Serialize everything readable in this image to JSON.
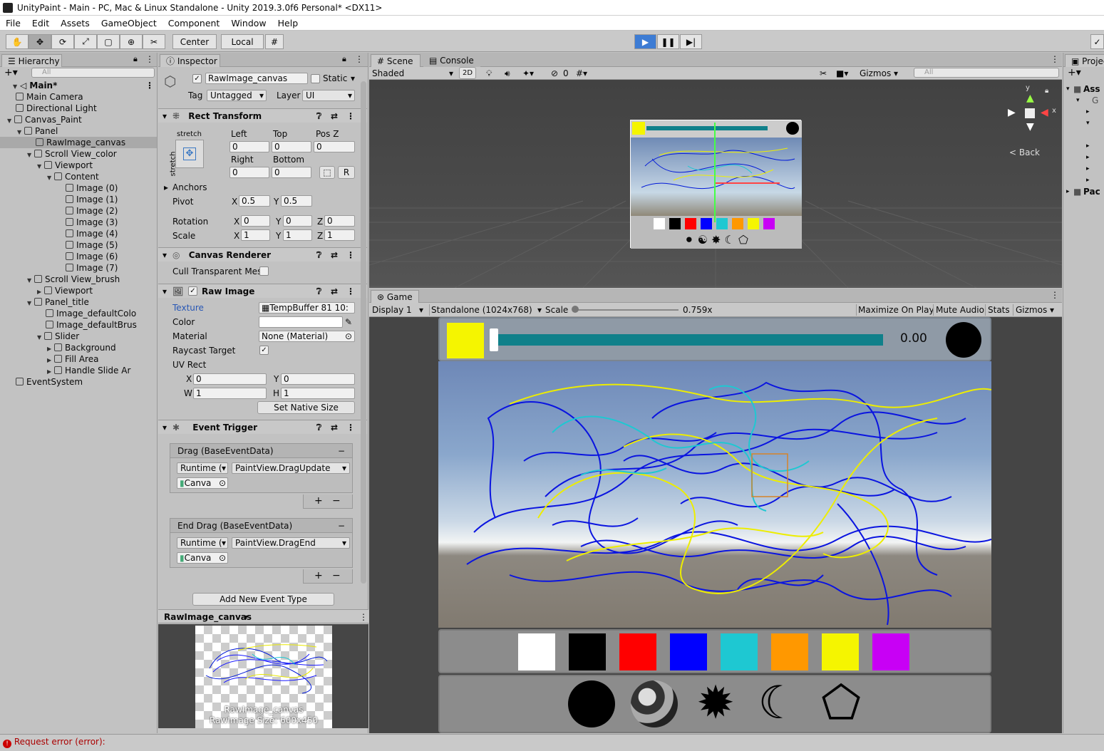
{
  "window_title": "UnityPaint - Main - PC, Mac & Linux Standalone - Unity 2019.3.0f6 Personal* <DX11>",
  "menu": [
    "File",
    "Edit",
    "Assets",
    "GameObject",
    "Component",
    "Window",
    "Help"
  ],
  "toolbar": {
    "center": "Center",
    "local": "Local"
  },
  "hierarchy": {
    "tab": "Hierarchy",
    "search": "All",
    "items": [
      {
        "label": "Main*",
        "depth": 0,
        "scene": true
      },
      {
        "label": "Main Camera",
        "depth": 1
      },
      {
        "label": "Directional Light",
        "depth": 1
      },
      {
        "label": "Canvas_Paint",
        "depth": 1
      },
      {
        "label": "Panel",
        "depth": 2
      },
      {
        "label": "RawImage_canvas",
        "depth": 3,
        "selected": true
      },
      {
        "label": "Scroll View_color",
        "depth": 3
      },
      {
        "label": "Viewport",
        "depth": 4
      },
      {
        "label": "Content",
        "depth": 5
      },
      {
        "label": "Image (0)",
        "depth": 6
      },
      {
        "label": "Image (1)",
        "depth": 6
      },
      {
        "label": "Image (2)",
        "depth": 6
      },
      {
        "label": "Image (3)",
        "depth": 6
      },
      {
        "label": "Image (4)",
        "depth": 6
      },
      {
        "label": "Image (5)",
        "depth": 6
      },
      {
        "label": "Image (6)",
        "depth": 6
      },
      {
        "label": "Image (7)",
        "depth": 6
      },
      {
        "label": "Scroll View_brush",
        "depth": 3
      },
      {
        "label": "Viewport",
        "depth": 4
      },
      {
        "label": "Panel_title",
        "depth": 3
      },
      {
        "label": "Image_defaultColo",
        "depth": 4
      },
      {
        "label": "Image_defaultBrus",
        "depth": 4
      },
      {
        "label": "Slider",
        "depth": 4
      },
      {
        "label": "Background",
        "depth": 5
      },
      {
        "label": "Fill Area",
        "depth": 5
      },
      {
        "label": "Handle Slide Ar",
        "depth": 5
      },
      {
        "label": "EventSystem",
        "depth": 1
      }
    ]
  },
  "inspector": {
    "tab": "Inspector",
    "object_name": "RawImage_canvas",
    "static": "Static",
    "tag_label": "Tag",
    "tag": "Untagged",
    "layer_label": "Layer",
    "layer": "UI",
    "rect_transform": {
      "title": "Rect Transform",
      "stretch": "stretch",
      "left_l": "Left",
      "top_l": "Top",
      "posz_l": "Pos Z",
      "left": "0",
      "top": "0",
      "posz": "0",
      "right_l": "Right",
      "bottom_l": "Bottom",
      "right": "0",
      "bottom": "0",
      "r": "R",
      "anchors": "Anchors",
      "pivot": "Pivot",
      "pivot_x": "0.5",
      "pivot_y": "0.5",
      "rotation": "Rotation",
      "rot_x": "0",
      "rot_y": "0",
      "rot_z": "0",
      "scale": "Scale",
      "scale_x": "1",
      "scale_y": "1",
      "scale_z": "1",
      "x": "X",
      "y": "Y",
      "z": "Z"
    },
    "canvas_renderer": {
      "title": "Canvas Renderer",
      "cull": "Cull Transparent Mes"
    },
    "raw_image": {
      "title": "Raw Image",
      "texture_l": "Texture",
      "texture": "TempBuffer 81 10:",
      "color_l": "Color",
      "material_l": "Material",
      "material": "None (Material)",
      "raycast_l": "Raycast Target",
      "uv_l": "UV Rect",
      "uv_x": "0",
      "uv_y": "0",
      "uv_w": "1",
      "uv_h": "1",
      "w": "W",
      "h": "H",
      "native": "Set Native Size"
    },
    "event_trigger": {
      "title": "Event Trigger",
      "entries": [
        {
          "name": "Drag (BaseEventData)",
          "runtime": "Runtime (",
          "func": "PaintView.DragUpdate",
          "obj": "Canva"
        },
        {
          "name": "End Drag (BaseEventData)",
          "runtime": "Runtime (",
          "func": "PaintView.DragEnd",
          "obj": "Canva"
        }
      ],
      "add": "Add New Event Type"
    },
    "preview": {
      "title": "RawImage_canvas",
      "caption1": "RawImage_canvas",
      "caption2": "RawImage Size: 600x450"
    }
  },
  "scene": {
    "tab": "Scene",
    "console_tab": "Console",
    "shaded": "Shaded",
    "mode2d": "2D",
    "zero": "0",
    "gizmos": "Gizmos",
    "search": "All",
    "back": "Back",
    "axis_x": "x",
    "axis_y": "y"
  },
  "game": {
    "tab": "Game",
    "display": "Display 1",
    "resolution": "Standalone (1024x768)",
    "scale_l": "Scale",
    "scale_v": "0.759x",
    "maximize": "Maximize On Play",
    "mute": "Mute Audio",
    "stats": "Stats",
    "gizmos": "Gizmos",
    "slider_value": "0.00"
  },
  "palette": [
    "#ffffff",
    "#000000",
    "#ff0000",
    "#0000ff",
    "#1ec8d2",
    "#ff9800",
    "#f5f500",
    "#c800f5"
  ],
  "project": {
    "tab": "Projec",
    "assets": "Ass",
    "packages": "Pac"
  },
  "status": {
    "message": "Request error (error):"
  }
}
